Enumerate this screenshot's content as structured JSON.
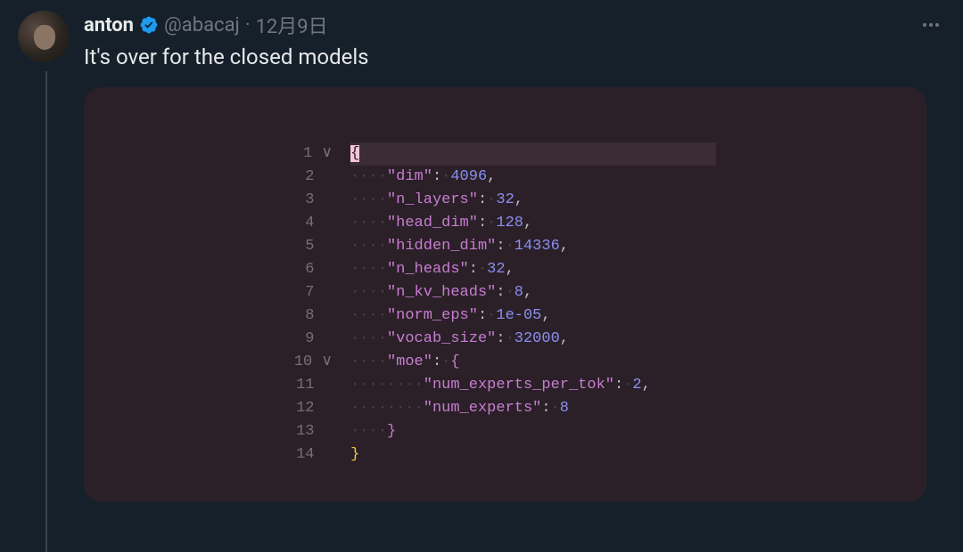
{
  "tweet": {
    "display_name": "anton",
    "handle": "@abacaj",
    "separator": "·",
    "date": "12月9日",
    "text": "It's over for the closed models"
  },
  "code": {
    "lines": [
      {
        "n": "1",
        "chev": "∨",
        "parts": [
          {
            "t": "brace-open-sel",
            "v": "{"
          }
        ]
      },
      {
        "n": "2",
        "chev": " ",
        "parts": [
          {
            "t": "ws",
            "v": "····"
          },
          {
            "t": "key",
            "v": "\"dim\""
          },
          {
            "t": "punct",
            "v": ":"
          },
          {
            "t": "ws",
            "v": "·"
          },
          {
            "t": "num",
            "v": "4096"
          },
          {
            "t": "punct",
            "v": ","
          }
        ]
      },
      {
        "n": "3",
        "chev": " ",
        "parts": [
          {
            "t": "ws",
            "v": "····"
          },
          {
            "t": "key",
            "v": "\"n_layers\""
          },
          {
            "t": "punct",
            "v": ":"
          },
          {
            "t": "ws",
            "v": "·"
          },
          {
            "t": "num",
            "v": "32"
          },
          {
            "t": "punct",
            "v": ","
          }
        ]
      },
      {
        "n": "4",
        "chev": " ",
        "parts": [
          {
            "t": "ws",
            "v": "····"
          },
          {
            "t": "key",
            "v": "\"head_dim\""
          },
          {
            "t": "punct",
            "v": ":"
          },
          {
            "t": "ws",
            "v": "·"
          },
          {
            "t": "num",
            "v": "128"
          },
          {
            "t": "punct",
            "v": ","
          }
        ]
      },
      {
        "n": "5",
        "chev": " ",
        "parts": [
          {
            "t": "ws",
            "v": "····"
          },
          {
            "t": "key",
            "v": "\"hidden_dim\""
          },
          {
            "t": "punct",
            "v": ":"
          },
          {
            "t": "ws",
            "v": "·"
          },
          {
            "t": "num",
            "v": "14336"
          },
          {
            "t": "punct",
            "v": ","
          }
        ]
      },
      {
        "n": "6",
        "chev": " ",
        "parts": [
          {
            "t": "ws",
            "v": "····"
          },
          {
            "t": "key",
            "v": "\"n_heads\""
          },
          {
            "t": "punct",
            "v": ":"
          },
          {
            "t": "ws",
            "v": "·"
          },
          {
            "t": "num",
            "v": "32"
          },
          {
            "t": "punct",
            "v": ","
          }
        ]
      },
      {
        "n": "7",
        "chev": " ",
        "parts": [
          {
            "t": "ws",
            "v": "····"
          },
          {
            "t": "key",
            "v": "\"n_kv_heads\""
          },
          {
            "t": "punct",
            "v": ":"
          },
          {
            "t": "ws",
            "v": "·"
          },
          {
            "t": "num",
            "v": "8"
          },
          {
            "t": "punct",
            "v": ","
          }
        ]
      },
      {
        "n": "8",
        "chev": " ",
        "parts": [
          {
            "t": "ws",
            "v": "····"
          },
          {
            "t": "key",
            "v": "\"norm_eps\""
          },
          {
            "t": "punct",
            "v": ":"
          },
          {
            "t": "ws",
            "v": "·"
          },
          {
            "t": "num",
            "v": "1e-05"
          },
          {
            "t": "punct",
            "v": ","
          }
        ]
      },
      {
        "n": "9",
        "chev": " ",
        "parts": [
          {
            "t": "ws",
            "v": "····"
          },
          {
            "t": "key",
            "v": "\"vocab_size\""
          },
          {
            "t": "punct",
            "v": ":"
          },
          {
            "t": "ws",
            "v": "·"
          },
          {
            "t": "num",
            "v": "32000"
          },
          {
            "t": "punct",
            "v": ","
          }
        ]
      },
      {
        "n": "10",
        "chev": "∨",
        "parts": [
          {
            "t": "ws",
            "v": "····"
          },
          {
            "t": "key",
            "v": "\"moe\""
          },
          {
            "t": "punct",
            "v": ":"
          },
          {
            "t": "ws",
            "v": "·"
          },
          {
            "t": "brace-inner",
            "v": "{"
          }
        ]
      },
      {
        "n": "11",
        "chev": " ",
        "parts": [
          {
            "t": "ws",
            "v": "········"
          },
          {
            "t": "key",
            "v": "\"num_experts_per_tok\""
          },
          {
            "t": "punct",
            "v": ":"
          },
          {
            "t": "ws",
            "v": "·"
          },
          {
            "t": "num",
            "v": "2"
          },
          {
            "t": "punct",
            "v": ","
          }
        ]
      },
      {
        "n": "12",
        "chev": " ",
        "parts": [
          {
            "t": "ws",
            "v": "········"
          },
          {
            "t": "key",
            "v": "\"num_experts\""
          },
          {
            "t": "punct",
            "v": ":"
          },
          {
            "t": "ws",
            "v": "·"
          },
          {
            "t": "num",
            "v": "8"
          }
        ]
      },
      {
        "n": "13",
        "chev": " ",
        "parts": [
          {
            "t": "ws",
            "v": "····"
          },
          {
            "t": "brace-inner",
            "v": "}"
          }
        ]
      },
      {
        "n": "14",
        "chev": " ",
        "parts": [
          {
            "t": "brace",
            "v": "}"
          }
        ]
      }
    ]
  }
}
